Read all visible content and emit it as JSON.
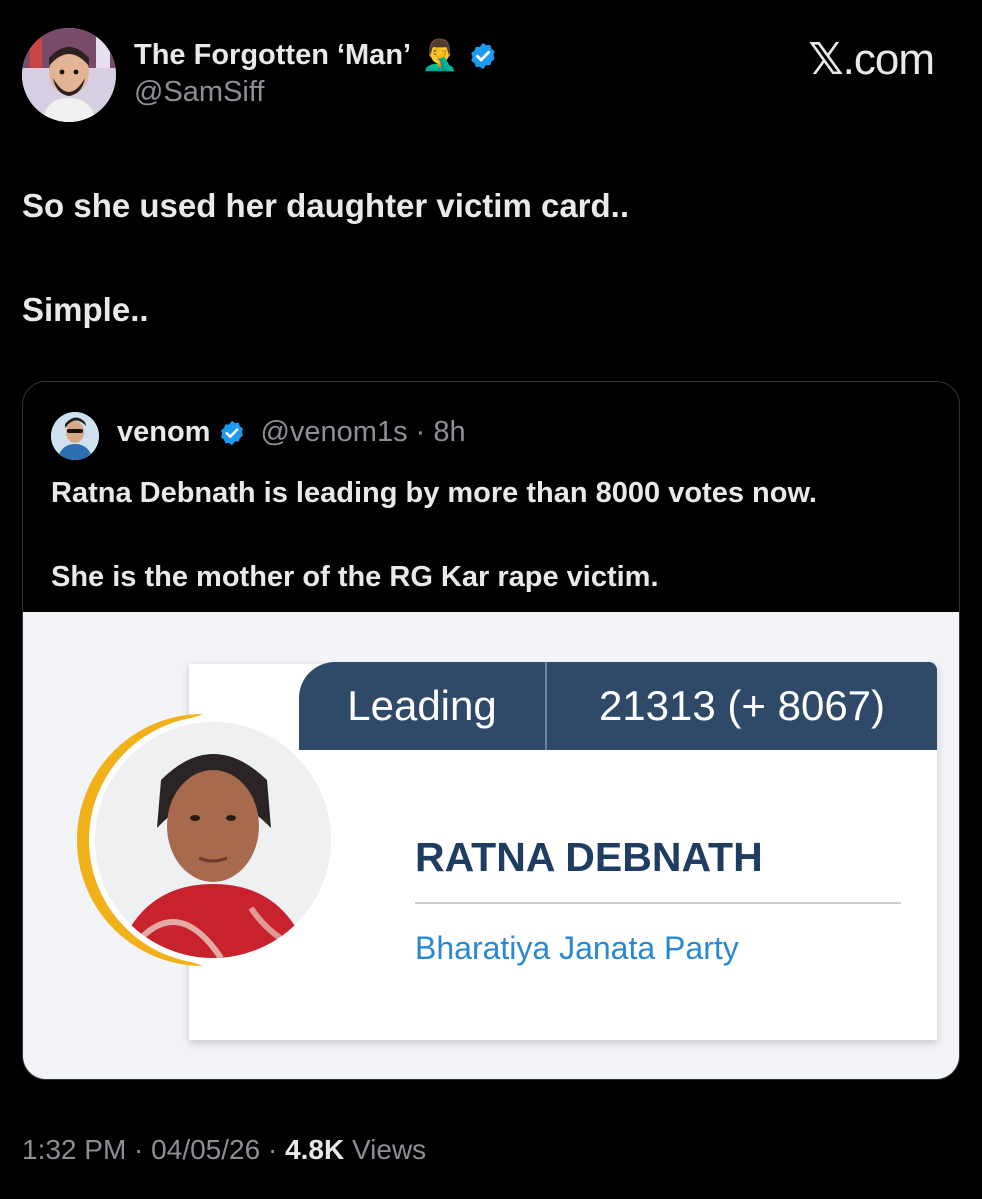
{
  "author": {
    "display_name": "The Forgotten ‘Man’",
    "emoji": "🤦‍♂️",
    "handle": "@SamSiff",
    "verified_icon": "verified-badge-icon"
  },
  "brand": {
    "x_glyph": "𝕏",
    "label": ".com"
  },
  "tweet": {
    "line1": "So she used her daughter victim card..",
    "line2": "Simple.."
  },
  "quote": {
    "name": "venom",
    "handle": "@venom1s",
    "time": "· 8h",
    "line1": "Ratna Debnath is leading by more than 8000 votes now.",
    "line2": "She is the mother of the RG Kar rape victim."
  },
  "result_card": {
    "status": "Leading",
    "votes": "21313 (+ 8067)",
    "candidate": "RATNA DEBNATH",
    "party": "Bharatiya Janata Party",
    "header_color": "#2f4a68",
    "name_color": "#1f3d63",
    "party_color": "#2a88d0",
    "ring_color": "#f2b019"
  },
  "footer": {
    "time": "1:32 PM",
    "sep1": " · ",
    "date": "04/05/26",
    "sep2": " · ",
    "views_count": "4.8K",
    "views_label": " Views"
  },
  "colors": {
    "background": "#000000",
    "text": "#e7e9ea",
    "muted": "#8b8f95",
    "verified": "#1d9bf0"
  }
}
